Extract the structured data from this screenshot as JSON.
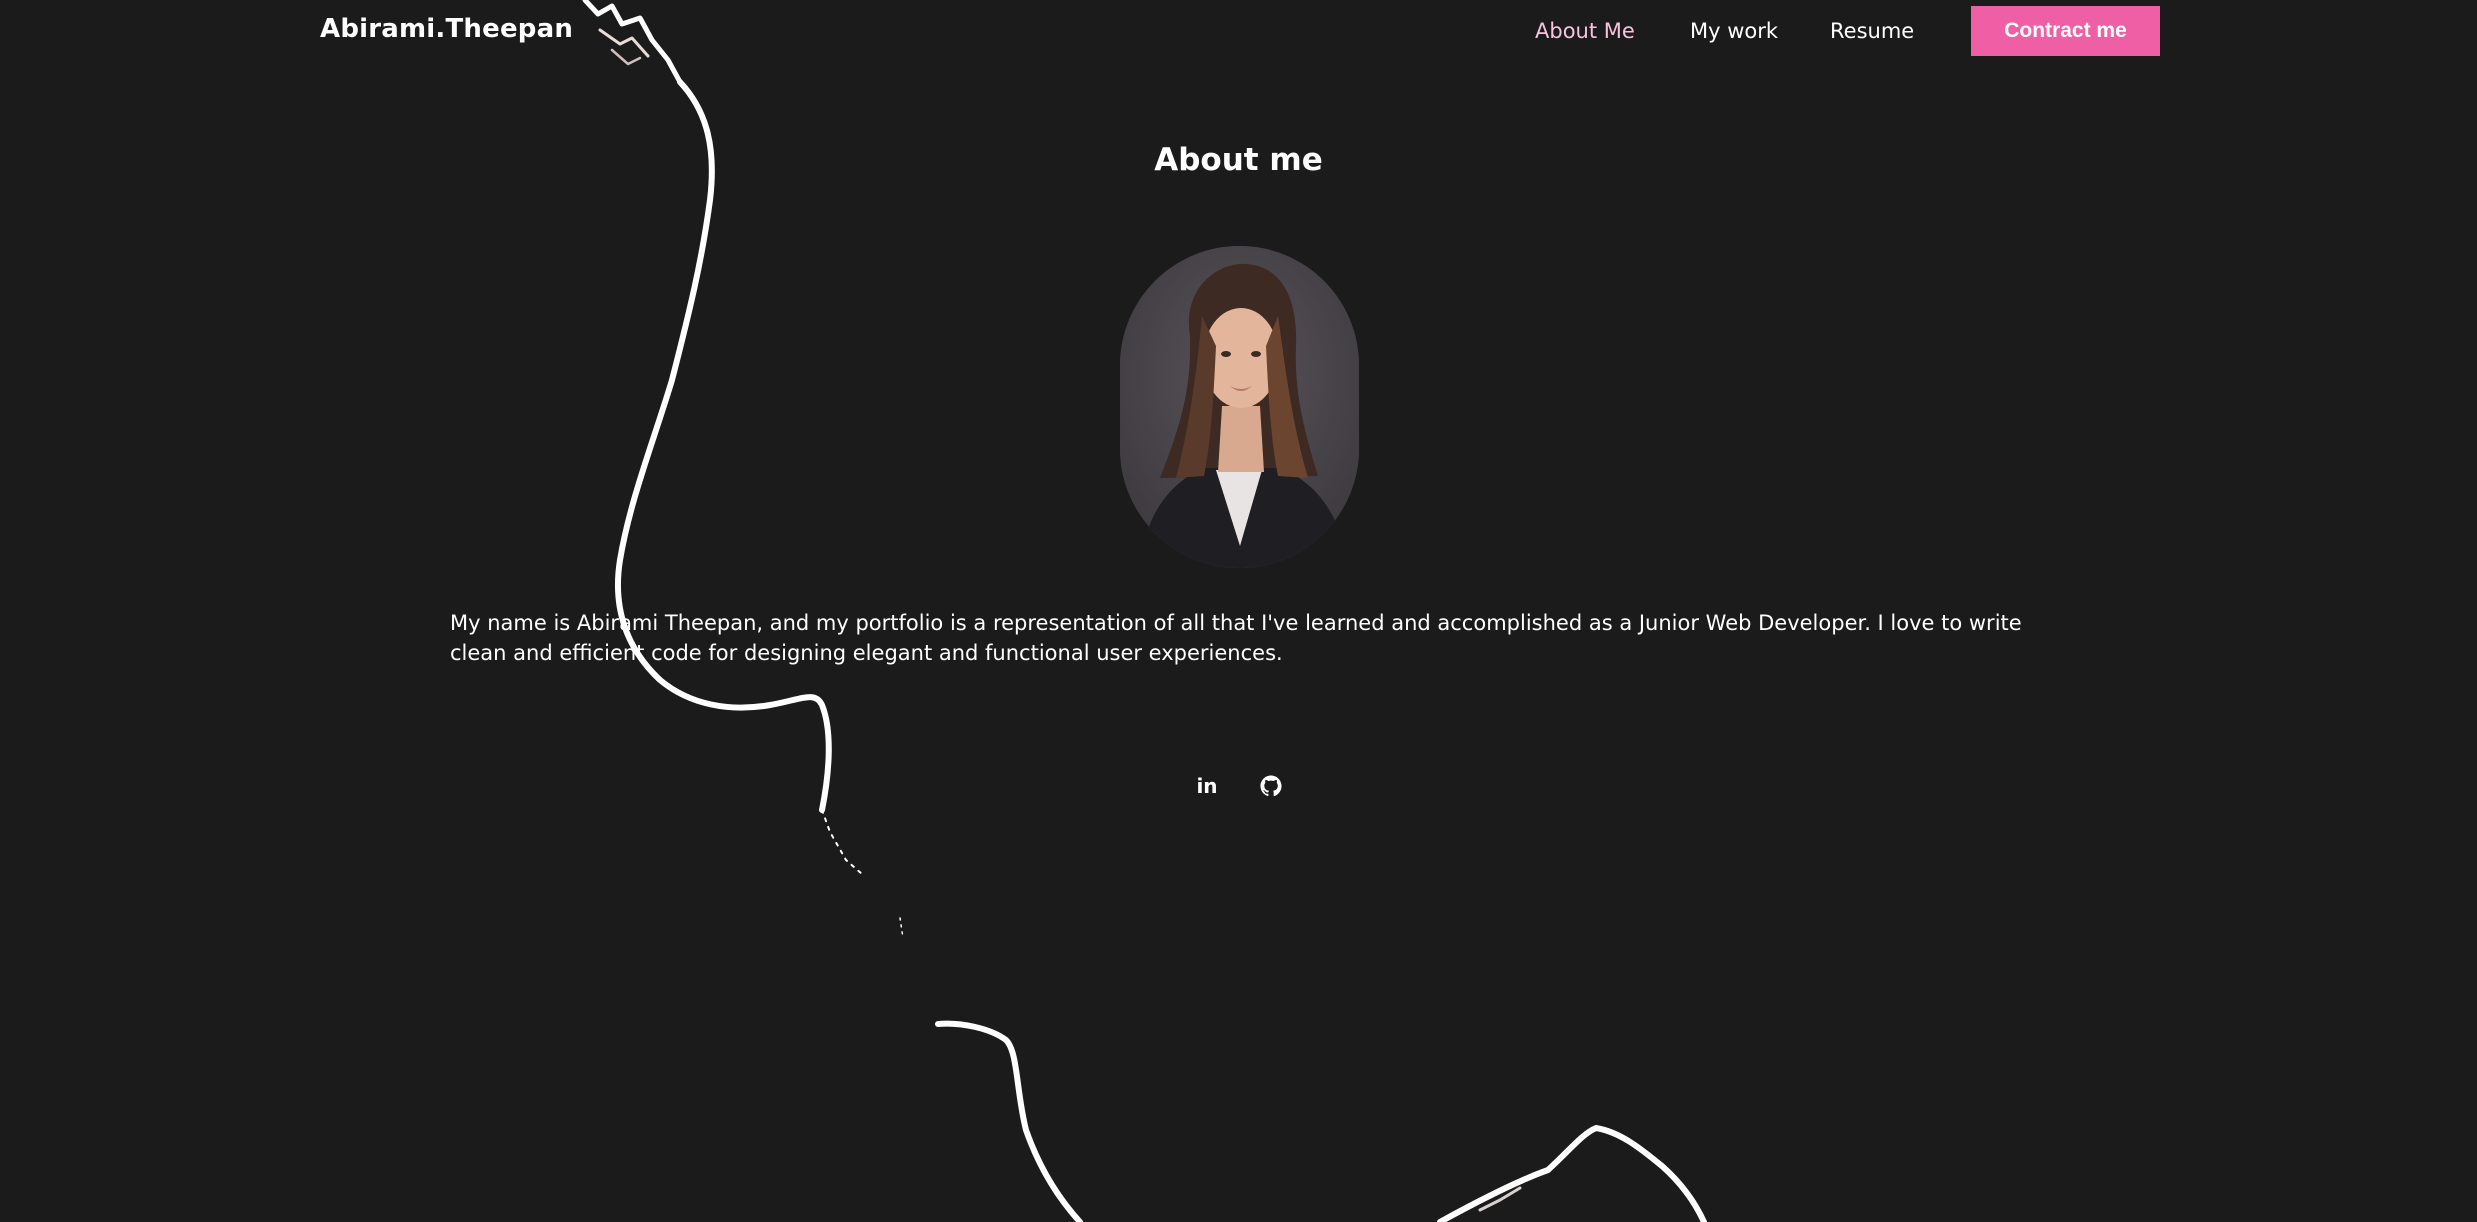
{
  "header": {
    "brand": "Abirami.Theepan",
    "nav": {
      "about": "About Me",
      "work": "My work",
      "resume": "Resume"
    },
    "contact_label": "Contract me"
  },
  "about": {
    "title": "About me",
    "bio": "My name is Abirami Theepan, and my portfolio is a representation of all that I've learned and accomplished as a Junior Web Developer. I love to write clean and efficient code for designing elegant and functional user experiences."
  },
  "social": {
    "linkedin_glyph": "in",
    "linkedin_icon": "linkedin-icon",
    "github_icon": "github-icon"
  },
  "colors": {
    "background": "#1b1b1b",
    "accent": "#ee5fa6",
    "active_nav": "#f7c3dc",
    "text": "#ffffff"
  }
}
